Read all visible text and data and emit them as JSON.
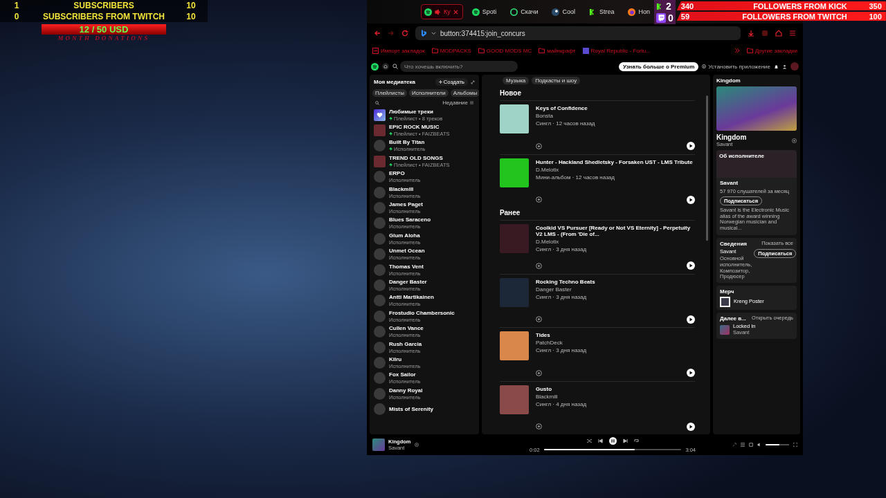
{
  "stream_overlay": {
    "subscriber_rows": [
      {
        "current": "1",
        "label": "SUBSCRIBERS",
        "goal": "10"
      },
      {
        "current": "0",
        "label": "SUBSCRIBERS FROM TWITCH",
        "goal": "10"
      }
    ],
    "donation": {
      "amount": "12 / 50 USD",
      "label": "MONTH DONATIONS"
    },
    "platform_counts": [
      {
        "kind": "kick",
        "count": "2"
      },
      {
        "kind": "twitch",
        "count": "0"
      }
    ],
    "follower_rows": [
      {
        "current": "340",
        "label": "FOLLOWERS FROM KICK",
        "goal": "350"
      },
      {
        "current": "59",
        "label": "FOLLOWERS FROM TWITCH",
        "goal": "100"
      }
    ]
  },
  "browser": {
    "tabs": [
      {
        "kind": "spotify",
        "label": "Ку",
        "selected": true,
        "audio": true
      },
      {
        "kind": "spotify",
        "label": "Spoti",
        "selected": false,
        "audio": false
      },
      {
        "kind": "download",
        "label": "Скачи",
        "selected": false,
        "audio": false
      },
      {
        "kind": "steam",
        "label": "Cool",
        "selected": false,
        "audio": false
      },
      {
        "kind": "kick",
        "label": "Strea",
        "selected": false,
        "audio": false
      },
      {
        "kind": "firefox",
        "label": "Hon",
        "selected": false,
        "audio": false
      }
    ],
    "address": "button:374415:join_concurs",
    "bookmarks": [
      {
        "kind": "import",
        "label": "Импорт закладок"
      },
      {
        "kind": "folder",
        "label": "MODPACKS"
      },
      {
        "kind": "folder",
        "label": "GOOD MODS MC"
      },
      {
        "kind": "folder",
        "label": "майнкрафт"
      },
      {
        "kind": "site",
        "label": "Royal Republic - Fortu..."
      }
    ],
    "other_bookmarks": "Другие закладки"
  },
  "spotify": {
    "search": {
      "placeholder": "Что хочешь включить?"
    },
    "premium_button": "Узнать больше о Premium",
    "install_link": "Установить приложение",
    "library": {
      "title": "Моя медиатека",
      "create": "Создать",
      "filters": [
        "Плейлисты",
        "Исполнители",
        "Альбомы"
      ],
      "sort": "Недавние",
      "items": [
        {
          "kind": "liked",
          "name": "Любимые треки",
          "subtitle": "Плейлист • 8 треков",
          "pinned": true
        },
        {
          "kind": "playlist",
          "name": "EPIC ROCK MUSIC",
          "subtitle": "Плейлист • FAIZBEATS",
          "pinned": true
        },
        {
          "kind": "artist",
          "name": "Built By Titan",
          "subtitle": "Исполнитель",
          "pinned": true
        },
        {
          "kind": "playlist",
          "name": "TREND OLD SONGS",
          "subtitle": "Плейлист • FAIZBEATS",
          "pinned": true
        },
        {
          "kind": "artist",
          "name": "ERPO",
          "subtitle": "Исполнитель",
          "pinned": false
        },
        {
          "kind": "artist",
          "name": "Blackmill",
          "subtitle": "Исполнитель",
          "pinned": false
        },
        {
          "kind": "artist",
          "name": "James Paget",
          "subtitle": "Исполнитель",
          "pinned": false
        },
        {
          "kind": "artist",
          "name": "Blues Saraceno",
          "subtitle": "Исполнитель",
          "pinned": false
        },
        {
          "kind": "artist",
          "name": "Glum Aloha",
          "subtitle": "Исполнитель",
          "pinned": false
        },
        {
          "kind": "artist",
          "name": "Unmet Ocean",
          "subtitle": "Исполнитель",
          "pinned": false
        },
        {
          "kind": "artist",
          "name": "Thomas Vent",
          "subtitle": "Исполнитель",
          "pinned": false
        },
        {
          "kind": "artist",
          "name": "Danger Baster",
          "subtitle": "Исполнитель",
          "pinned": false
        },
        {
          "kind": "artist",
          "name": "Antti Martikainen",
          "subtitle": "Исполнитель",
          "pinned": false
        },
        {
          "kind": "artist",
          "name": "Frostudio Chambersonic",
          "subtitle": "Исполнитель",
          "pinned": false
        },
        {
          "kind": "artist",
          "name": "Cullen Vance",
          "subtitle": "Исполнитель",
          "pinned": false
        },
        {
          "kind": "artist",
          "name": "Rush Garcia",
          "subtitle": "Исполнитель",
          "pinned": false
        },
        {
          "kind": "artist",
          "name": "Kilru",
          "subtitle": "Исполнитель",
          "pinned": false
        },
        {
          "kind": "artist",
          "name": "Fox Sailor",
          "subtitle": "Исполнитель",
          "pinned": false
        },
        {
          "kind": "artist",
          "name": "Danny Royal",
          "subtitle": "Исполнитель",
          "pinned": false
        },
        {
          "kind": "artist",
          "name": "Mists of Serenity"
        }
      ]
    },
    "feed": {
      "chips": [
        {
          "label": "Музыка",
          "selected": false
        },
        {
          "label": "Подкасты и шоу",
          "selected": false
        }
      ],
      "sections": [
        {
          "heading": "Новое",
          "releases": [
            {
              "title": "Keys of Confidence",
              "artist": "Bonsta",
              "meta": "Сингл · 12 часов назад",
              "color": "#9fd3c8"
            },
            {
              "title": "Hunter - Hackland Shedletsky - Forsaken UST - LMS Tribute",
              "artist": "D.Melotix",
              "meta": "Мини-альбом · 12 часов назад",
              "color": "#22c41e"
            }
          ]
        },
        {
          "heading": "Ранее",
          "releases": [
            {
              "title": "Coolkid VS Pursuer [Ready or Not VS Eternity] - Perpetuity V2 LMS - (From 'Die of...",
              "artist": "D.Melotix",
              "meta": "Сингл · 3 дня назад",
              "color": "#3a1a22"
            },
            {
              "title": "Rocking Techno Beats",
              "artist": "Danger Baster",
              "meta": "Сингл · 3 дня назад",
              "color": "#1c2838"
            },
            {
              "title": "Tides",
              "artist": "PatchDeck",
              "meta": "Сингл · 3 дня назад",
              "color": "#d9874a"
            },
            {
              "title": "Gusto",
              "artist": "Blackmill",
              "meta": "Сингл · 4 дня назад",
              "color": "#8a4a4a"
            }
          ]
        }
      ]
    },
    "now_playing_panel": {
      "header": "Kingdom",
      "title": "Kingdom",
      "artist": "Savant",
      "about": {
        "heading": "Об исполнителе",
        "name": "Savant",
        "listeners": "57 970 слушателей за месяц",
        "follow": "Подписаться",
        "bio": "Savant is the Electronic Music alias of the award winning Norwegian musician and musical..."
      },
      "credits": {
        "heading": "Сведения",
        "show_all": "Показать все",
        "name": "Savant",
        "roles": "Основной исполнитель, Композитор, Продюсер",
        "follow": "Подписаться"
      },
      "merch": {
        "heading": "Мерч",
        "item": "Kreng Poster"
      },
      "queue": {
        "heading": "Далее в...",
        "open": "Открыть очередь",
        "title": "Locked In",
        "artist": "Savant"
      }
    },
    "player": {
      "title": "Kingdom",
      "artist": "Savant",
      "elapsed": "0:02",
      "duration": "3:04",
      "playing": true,
      "level": 0.66,
      "volume": {
        "level": 0.6
      }
    }
  }
}
